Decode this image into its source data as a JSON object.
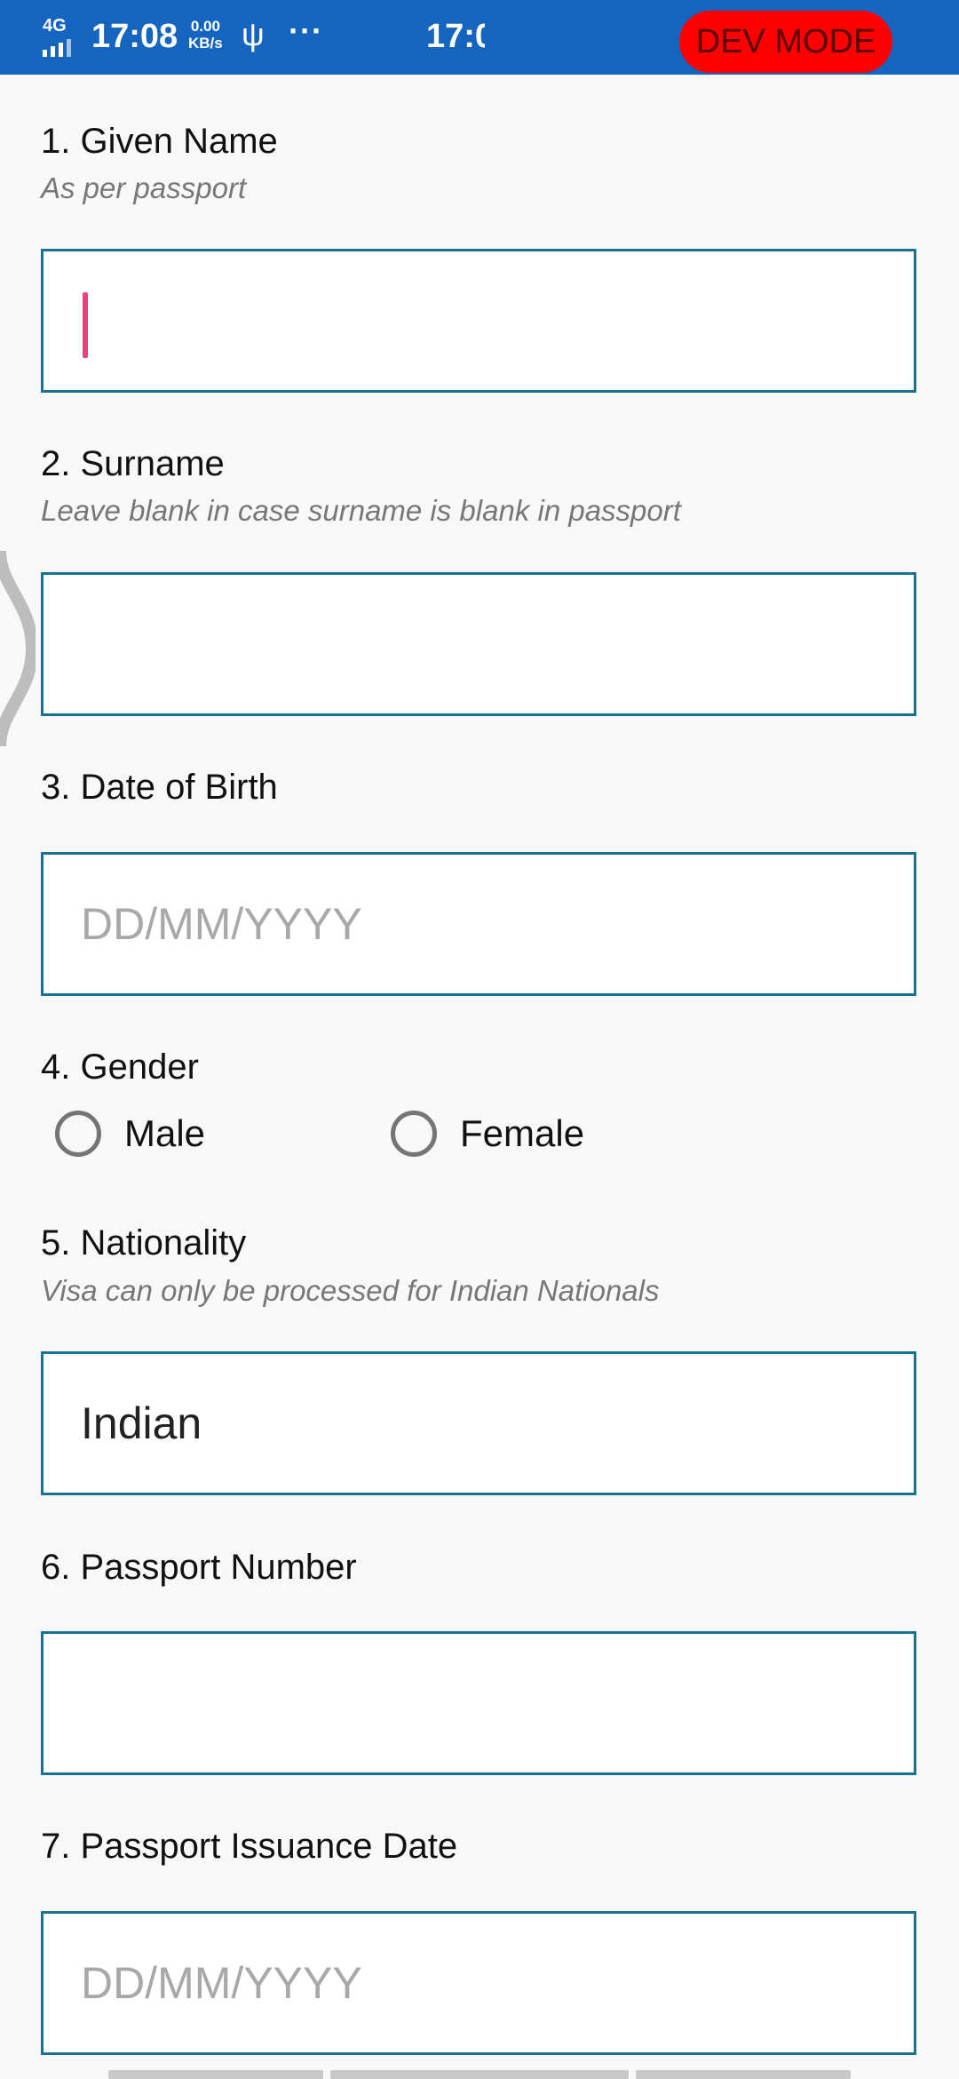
{
  "status_bar": {
    "network": "4G",
    "time": "17:08",
    "speed_value": "0.00",
    "speed_unit": "KB/s",
    "more": "···",
    "time_duplicate": "17:0",
    "dev_mode_badge": "DEV MODE"
  },
  "form": {
    "given_name": {
      "label": "1. Given Name",
      "hint": "As per passport",
      "value": "",
      "placeholder": ""
    },
    "surname": {
      "label": "2. Surname",
      "hint": "Leave blank in case surname is blank in passport",
      "value": "",
      "placeholder": ""
    },
    "date_of_birth": {
      "label": "3. Date of Birth",
      "value": "",
      "placeholder": "DD/MM/YYYY"
    },
    "gender": {
      "label": "4. Gender",
      "options": [
        "Male",
        "Female"
      ],
      "selected": null
    },
    "nationality": {
      "label": "5. Nationality",
      "hint": "Visa can only be processed for Indian Nationals",
      "value": "Indian"
    },
    "passport_number": {
      "label": "6. Passport Number",
      "value": "",
      "placeholder": ""
    },
    "passport_issuance_date": {
      "label": "7. Passport Issuance Date",
      "value": "",
      "placeholder": "DD/MM/YYYY"
    }
  },
  "colors": {
    "status_bar": "#1565c0",
    "dev_mode": "#ff0000",
    "field_border": "#1a7191",
    "caret": "#ec407a"
  }
}
